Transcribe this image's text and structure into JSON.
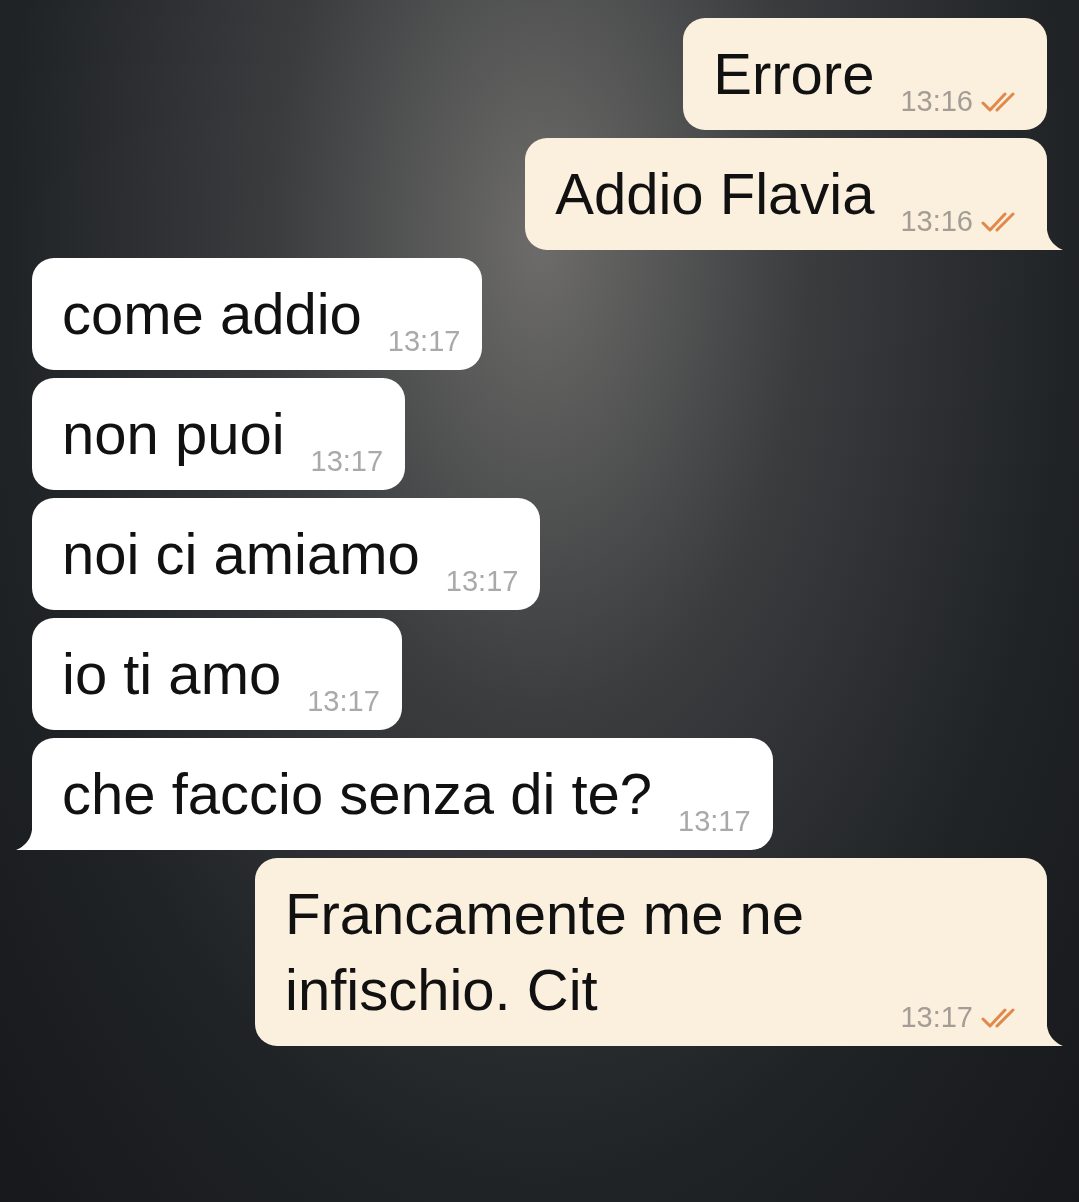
{
  "messages": [
    {
      "kind": "outgoing",
      "text": "Errore",
      "time": "13:16",
      "read": true,
      "tail": false
    },
    {
      "kind": "outgoing",
      "text": "Addio Flavia",
      "time": "13:16",
      "read": true,
      "tail": true
    },
    {
      "kind": "incoming",
      "text": "come addio",
      "time": "13:17",
      "tail": false
    },
    {
      "kind": "incoming",
      "text": "non puoi",
      "time": "13:17",
      "tail": false
    },
    {
      "kind": "incoming",
      "text": "noi ci amiamo",
      "time": "13:17",
      "tail": false
    },
    {
      "kind": "incoming",
      "text": "io ti amo",
      "time": "13:17",
      "tail": false
    },
    {
      "kind": "incoming",
      "text": "che faccio senza di te?",
      "time": "13:17",
      "tail": true
    },
    {
      "kind": "outgoing",
      "text": "Francamente me ne infischio. Cit",
      "time": "13:17",
      "read": true,
      "tail": true
    }
  ]
}
